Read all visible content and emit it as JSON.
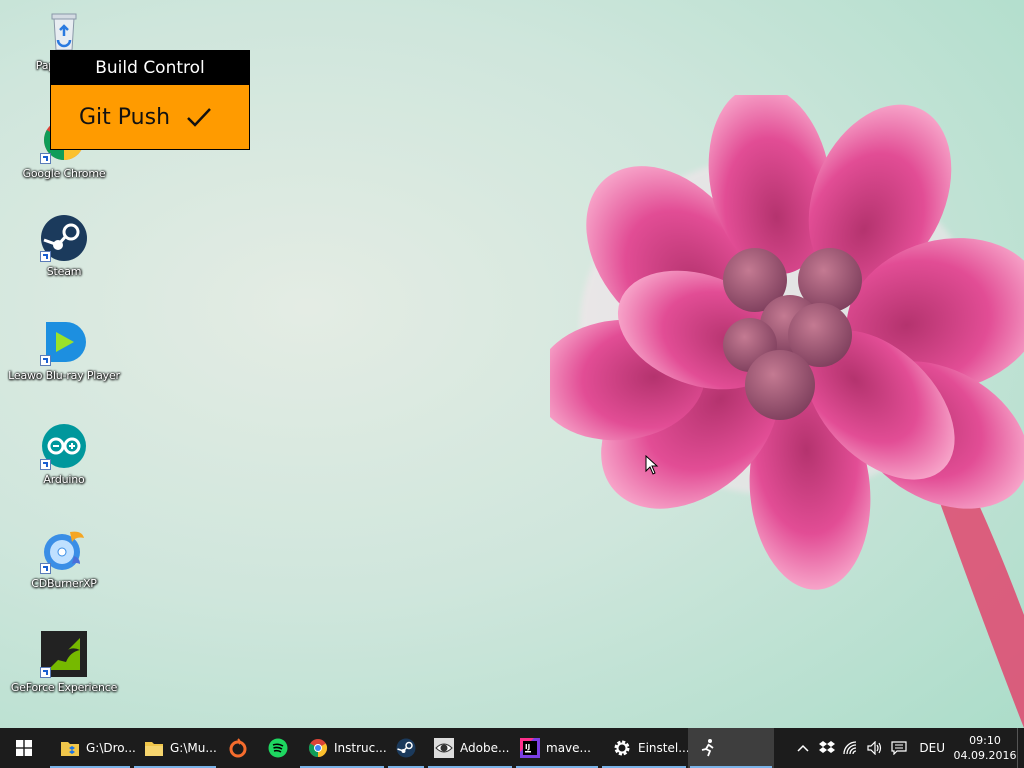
{
  "desktop": {
    "icons": [
      {
        "label": "Papierkorb",
        "icon": "recycle-bin-icon"
      },
      {
        "label": "Google Chrome",
        "icon": "chrome-icon"
      },
      {
        "label": "Steam",
        "icon": "steam-icon"
      },
      {
        "label": "Leawo Blu-ray Player",
        "icon": "leawo-player-icon"
      },
      {
        "label": "Arduino",
        "icon": "arduino-icon"
      },
      {
        "label": "CDBurnerXP",
        "icon": "cdburnerxp-icon"
      },
      {
        "label": "GeForce Experience",
        "icon": "geforce-icon"
      }
    ]
  },
  "build_control": {
    "title": "Build Control",
    "action": "Git Push",
    "status_icon": "checkmark-icon",
    "accent": "#ff9b00"
  },
  "taskbar": {
    "items": [
      {
        "label": "G:\\Dro...",
        "icon": "dropbox-folder-icon"
      },
      {
        "label": "G:\\Mu...",
        "icon": "folder-icon"
      },
      {
        "label": "",
        "icon": "origin-icon"
      },
      {
        "label": "",
        "icon": "spotify-icon"
      },
      {
        "label": "Instruc...",
        "icon": "chrome-icon"
      },
      {
        "label": "",
        "icon": "steam-icon"
      },
      {
        "label": "Adobe...",
        "icon": "adobe-eye-icon"
      },
      {
        "label": "mave...",
        "icon": "intellij-icon"
      },
      {
        "label": "Einstel...",
        "icon": "settings-gear-icon"
      },
      {
        "label": "",
        "icon": "runner-app-icon"
      }
    ],
    "tray": {
      "language": "DEU",
      "time": "09:10",
      "date": "04.09.2016"
    }
  }
}
